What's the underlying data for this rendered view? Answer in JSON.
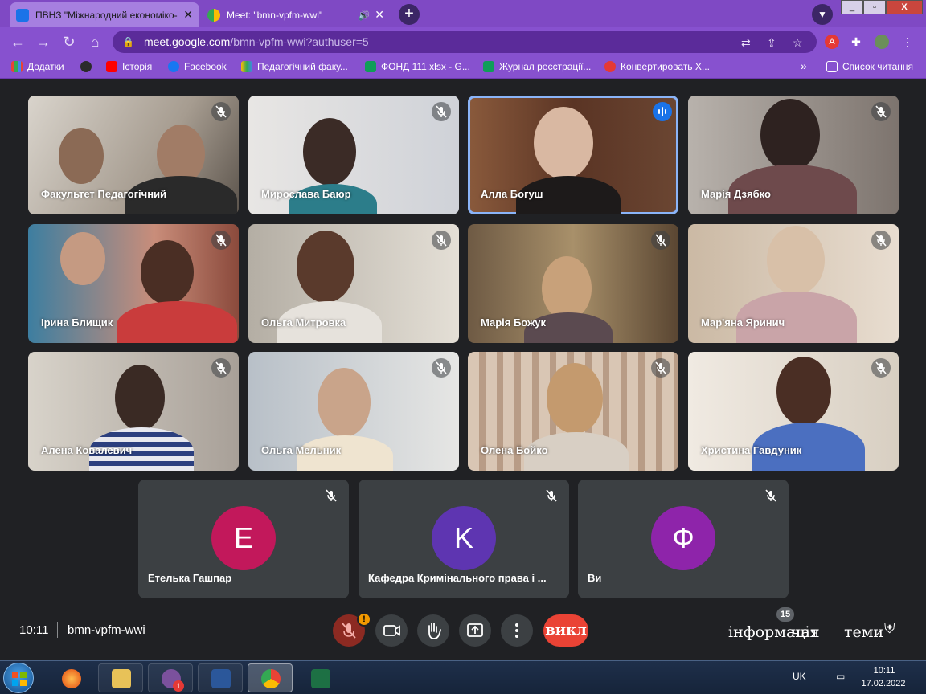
{
  "browser": {
    "tabs": [
      {
        "title": "ПВНЗ \"Міжнародний економіко-гуманітарний університет\""
      },
      {
        "title": "Meet: \"bmn-vpfm-wwi\""
      }
    ],
    "url_host": "meet.google.com",
    "url_path": "/bmn-vpfm-wwi?authuser=5",
    "bookmarks": [
      "Додатки",
      "Історія",
      "Facebook",
      "Педагогічний факу...",
      "ФОНД 111.xlsx - G...",
      "Журнал реєстрації...",
      "Конвертировать Х..."
    ],
    "more_bookmarks": "»",
    "reading_list": "Список читання"
  },
  "meet": {
    "participants": [
      {
        "name": "Факультет Педагогічний"
      },
      {
        "name": "Мирослава Баюр"
      },
      {
        "name": "Алла Богуш"
      },
      {
        "name": "Марія Дзябко"
      },
      {
        "name": "Ірина Блищик"
      },
      {
        "name": "Ольга Митровка"
      },
      {
        "name": "Марія Божук"
      },
      {
        "name": "Мар'яна Яринич"
      },
      {
        "name": "Алена Ковалевич"
      },
      {
        "name": "Ольга Мельник"
      },
      {
        "name": "Олена Бойко"
      },
      {
        "name": "Христина Гавдуник"
      }
    ],
    "avatar_participants": [
      {
        "initial": "E",
        "name": "Етелька Гашпар",
        "color": "#c2185b"
      },
      {
        "initial": "K",
        "name": "Кафедра Кримінального права і ...",
        "color": "#5e35b1"
      },
      {
        "initial": "Ф",
        "name": "Ви",
        "color": "#8e24aa"
      }
    ],
    "time": "10:11",
    "meeting_code": "bmn-vpfm-wwi",
    "end_label": "викл",
    "info_label": "інформація",
    "chat_label": "чат",
    "people_count": "15",
    "activities_label": "теми",
    "warning_glyph": "!",
    "speaking_color": "#1a73e8"
  },
  "taskbar": {
    "lang": "UK",
    "time": "10:11",
    "date": "17.02.2022",
    "viber_badge": "1"
  }
}
